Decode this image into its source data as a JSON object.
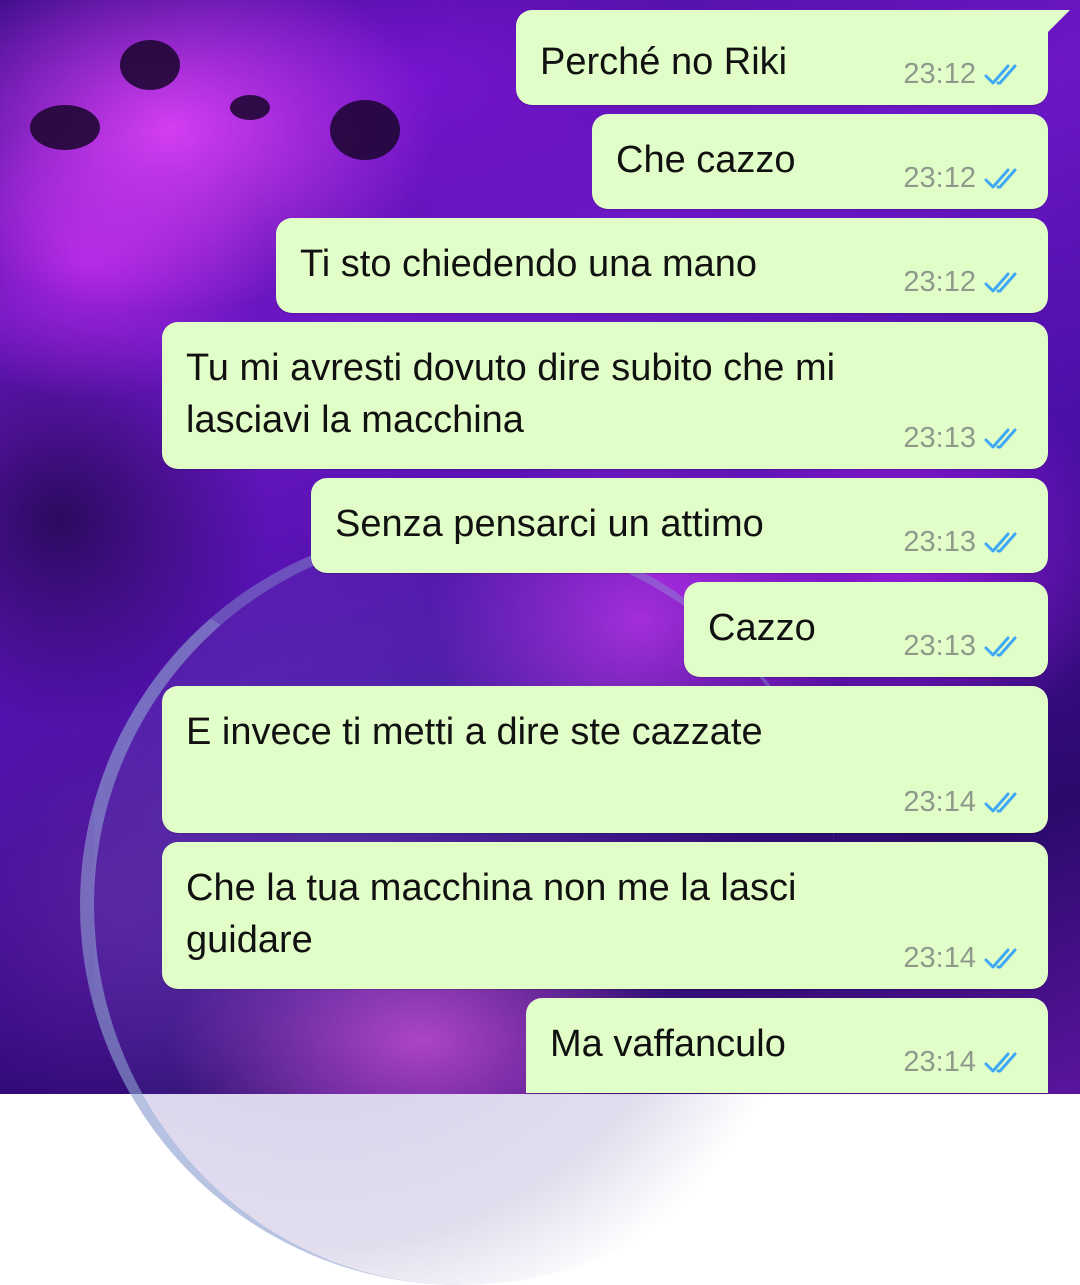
{
  "theme": {
    "bubble_color": "#e2fec8",
    "time_color": "#8f9a8c",
    "tick_color": "#3fa9f5"
  },
  "messages": [
    {
      "text": "Perché no Riki",
      "time": "23:12",
      "status_icon": "double-check-read-icon"
    },
    {
      "text": "Che cazzo",
      "time": "23:12",
      "status_icon": "double-check-read-icon"
    },
    {
      "text": "Ti sto chiedendo una mano",
      "time": "23:12",
      "status_icon": "double-check-read-icon"
    },
    {
      "text": "Tu mi avresti dovuto dire subito che mi lasciavi la macchina",
      "time": "23:13",
      "status_icon": "double-check-read-icon"
    },
    {
      "text": "Senza pensarci un attimo",
      "time": "23:13",
      "status_icon": "double-check-read-icon"
    },
    {
      "text": "Cazzo",
      "time": "23:13",
      "status_icon": "double-check-read-icon"
    },
    {
      "text": "E invece ti metti a dire ste cazzate",
      "time": "23:14",
      "status_icon": "double-check-read-icon"
    },
    {
      "text": "Che la tua macchina non me la lasci guidare",
      "time": "23:14",
      "status_icon": "double-check-read-icon"
    },
    {
      "text": "Ma vaffanculo",
      "time": "23:14",
      "status_icon": "double-check-read-icon"
    }
  ]
}
